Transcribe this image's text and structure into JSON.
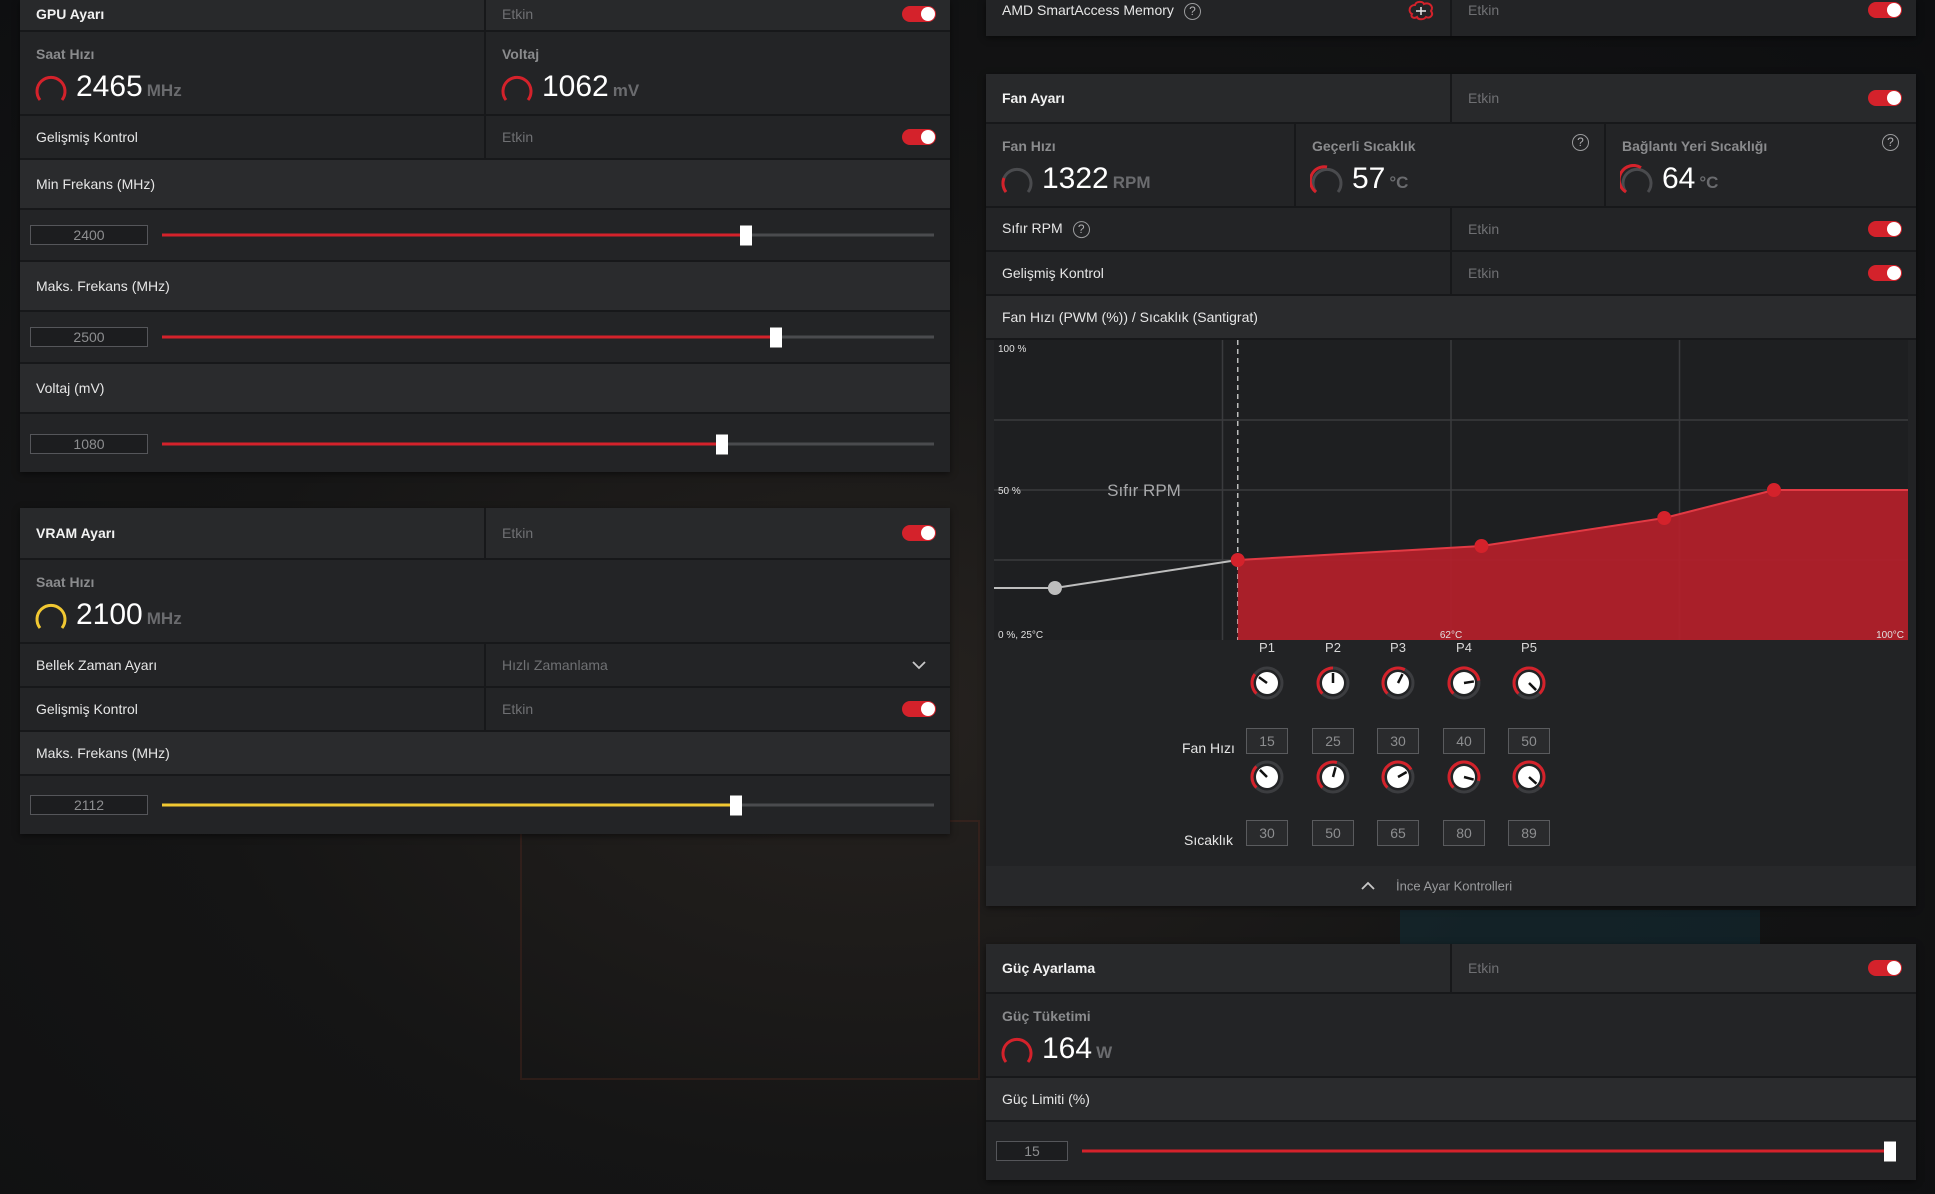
{
  "colors": {
    "accent_red": "#d4222b",
    "accent_yellow": "#f1c832",
    "panel_bg": "#222325",
    "muted_text": "#6f7073"
  },
  "gpu": {
    "title": "GPU Ayarı",
    "enabled_text": "Etkin",
    "clock_title": "Saat Hızı",
    "clock_value": "2465",
    "clock_unit": "MHz",
    "voltage_title": "Voltaj",
    "voltage_value": "1062",
    "voltage_unit": "mV",
    "advanced_label": "Gelişmiş Kontrol",
    "advanced_enabled": "Etkin",
    "min_freq_label": "Min Frekans (MHz)",
    "min_freq_value": "2400",
    "min_freq_fraction": 0.757,
    "max_freq_label": "Maks. Frekans (MHz)",
    "max_freq_value": "2500",
    "max_freq_fraction": 0.795,
    "volt_label": "Voltaj (mV)",
    "volt_value": "1080",
    "volt_fraction": 0.725
  },
  "vram": {
    "title": "VRAM Ayarı",
    "enabled_text": "Etkin",
    "clock_title": "Saat Hızı",
    "clock_value": "2100",
    "clock_unit": "MHz",
    "timing_label": "Bellek Zaman Ayarı",
    "timing_value": "Hızlı Zamanlama",
    "advanced_label": "Gelişmiş Kontrol",
    "advanced_enabled": "Etkin",
    "max_freq_label": "Maks. Frekans (MHz)",
    "max_freq_value": "2112",
    "max_freq_fraction": 0.744
  },
  "sam": {
    "label": "AMD SmartAccess Memory",
    "enabled_text": "Etkin"
  },
  "fan": {
    "title": "Fan Ayarı",
    "enabled_text": "Etkin",
    "speed_title": "Fan Hızı",
    "speed_value": "1322",
    "speed_unit": "RPM",
    "temp_title": "Geçerli Sıcaklık",
    "temp_value": "57",
    "temp_unit": "°C",
    "junction_title": "Bağlantı Yeri Sıcaklığı",
    "junction_value": "64",
    "junction_unit": "°C",
    "zero_rpm_label": "Sıfır RPM",
    "zero_rpm_enabled": "Etkin",
    "advanced_label": "Gelişmiş Kontrol",
    "advanced_enabled": "Etkin",
    "curve_label": "Fan Hızı (PWM (%)) / Sıcaklık (Santigrat)",
    "fine_tune_label": "İnce Ayar Kontrolleri",
    "row_fan_label": "Fan Hızı",
    "row_temp_label": "Sıcaklık",
    "points": [
      {
        "name": "P1",
        "speed": "15",
        "temp": "30"
      },
      {
        "name": "P2",
        "speed": "25",
        "temp": "50"
      },
      {
        "name": "P3",
        "speed": "30",
        "temp": "65"
      },
      {
        "name": "P4",
        "speed": "40",
        "temp": "80"
      },
      {
        "name": "P5",
        "speed": "50",
        "temp": "89"
      }
    ]
  },
  "chart_data": {
    "type": "area",
    "title": "",
    "xlabel": "",
    "ylabel": "",
    "xlim": [
      25,
      100
    ],
    "ylim": [
      0,
      100
    ],
    "tick_labels": {
      "y_top": "100 %",
      "y_mid": "50 %",
      "origin": "0 %, 25°C",
      "x_mid": "62°C",
      "x_end": "100°C"
    },
    "zone_label": "Sıfır RPM",
    "zero_rpm_threshold_temp": 45,
    "series": [
      {
        "name": "",
        "x": [
          30,
          45,
          65,
          80,
          89,
          100
        ],
        "y": [
          15,
          25,
          30,
          40,
          50,
          50
        ]
      }
    ],
    "grid": true
  },
  "power": {
    "title": "Güç Ayarlama",
    "enabled_text": "Etkin",
    "consumption_title": "Güç Tüketimi",
    "consumption_value": "164",
    "consumption_unit": "W",
    "limit_label": "Güç Limiti (%)",
    "limit_value": "15",
    "limit_fraction": 1.0
  }
}
